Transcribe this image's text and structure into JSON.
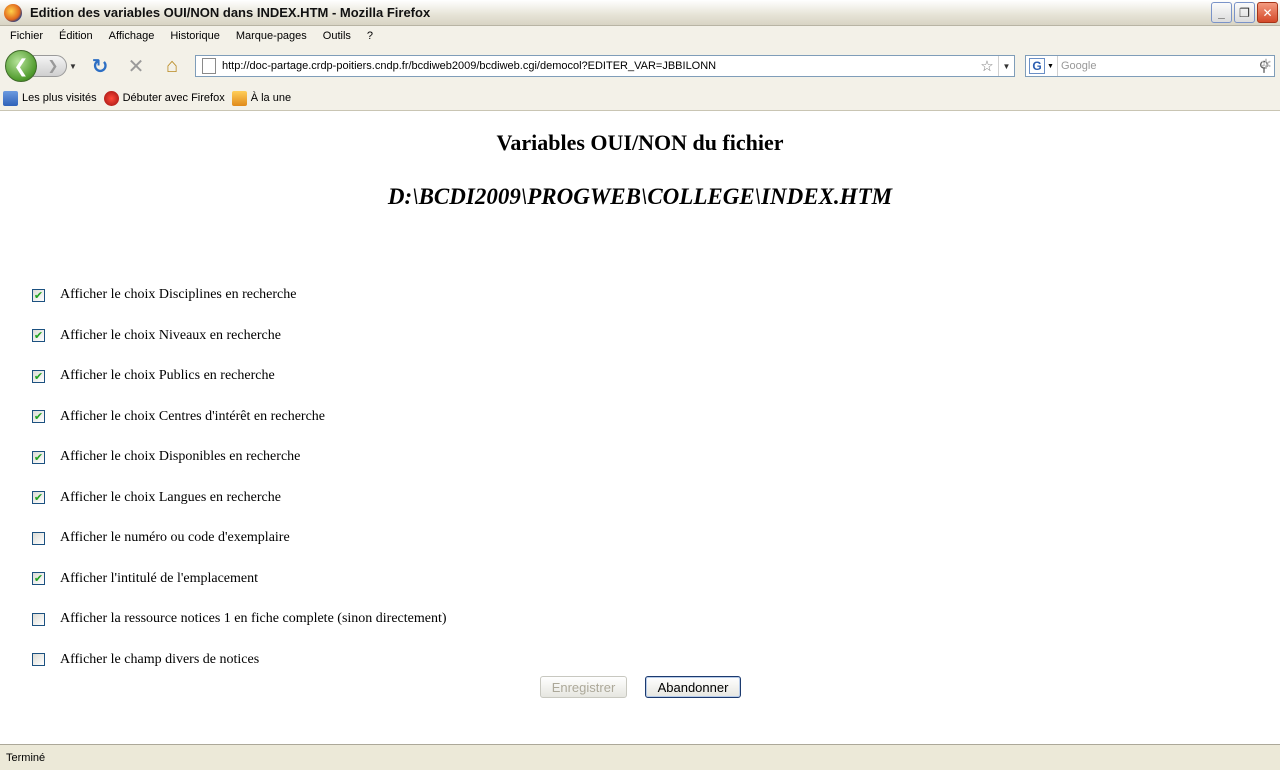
{
  "window": {
    "title": "Edition des variables OUI/NON dans INDEX.HTM - Mozilla Firefox",
    "controls": {
      "minimize": "_",
      "maximize": "❐",
      "close": "✕"
    }
  },
  "menu": [
    {
      "label": "Fichier"
    },
    {
      "label": "Édition"
    },
    {
      "label": "Affichage"
    },
    {
      "label": "Historique"
    },
    {
      "label": "Marque-pages"
    },
    {
      "label": "Outils"
    },
    {
      "label": "?"
    }
  ],
  "nav": {
    "back_glyph": "❮",
    "forward_glyph": "❯",
    "dropdown_glyph": "▼",
    "reload_glyph": "↻",
    "stop_glyph": "✕",
    "home_glyph": "⌂",
    "url": "http://doc-partage.crdp-poitiers.cndp.fr/bcdiweb2009/bcdiweb.cgi/democol?EDITER_VAR=JBBILONN",
    "bookmark_star_glyph": "☆",
    "search_engine_glyph": "G",
    "search_placeholder": "Google",
    "search_glyph": "⚲",
    "throbber_glyph": "✲",
    "icons": [
      "back-arrow-icon",
      "forward-arrow-icon",
      "reload-icon",
      "stop-icon",
      "home-icon",
      "page-icon",
      "bookmark-star-icon",
      "google-icon",
      "magnifier-icon"
    ]
  },
  "bookmarks": [
    {
      "label": "Les plus visités",
      "icon": "most-visited-icon"
    },
    {
      "label": "Débuter avec Firefox",
      "icon": "firefox-icon"
    },
    {
      "label": "À la une",
      "icon": "rss-icon"
    }
  ],
  "page": {
    "heading": "Variables OUI/NON du fichier",
    "file_path": "D:\\BCDI2009\\PROGWEB\\COLLEGE\\INDEX.HTM",
    "options": [
      {
        "label": "Afficher le choix Disciplines en recherche",
        "checked": true
      },
      {
        "label": "Afficher le choix Niveaux en recherche",
        "checked": true
      },
      {
        "label": "Afficher le choix Publics en recherche",
        "checked": true
      },
      {
        "label": "Afficher le choix Centres d'intérêt en recherche",
        "checked": true
      },
      {
        "label": "Afficher le choix Disponibles en recherche",
        "checked": true
      },
      {
        "label": "Afficher le choix Langues en recherche",
        "checked": true
      },
      {
        "label": "Afficher le numéro ou code d'exemplaire",
        "checked": false
      },
      {
        "label": "Afficher l'intitulé de l'emplacement",
        "checked": true
      },
      {
        "label": "Afficher la ressource notices 1 en fiche complete (sinon directement)",
        "checked": false
      },
      {
        "label": "Afficher le champ divers de notices",
        "checked": false
      }
    ],
    "save_label": "Enregistrer",
    "cancel_label": "Abandonner",
    "check_glyph": "✔"
  },
  "status": {
    "text": "Terminé"
  },
  "colors": {
    "checkmark": "#21a121",
    "checkbox_border": "#1c5180",
    "chrome": "#ece9d8",
    "primary_button_border": "#1c3a6e"
  }
}
